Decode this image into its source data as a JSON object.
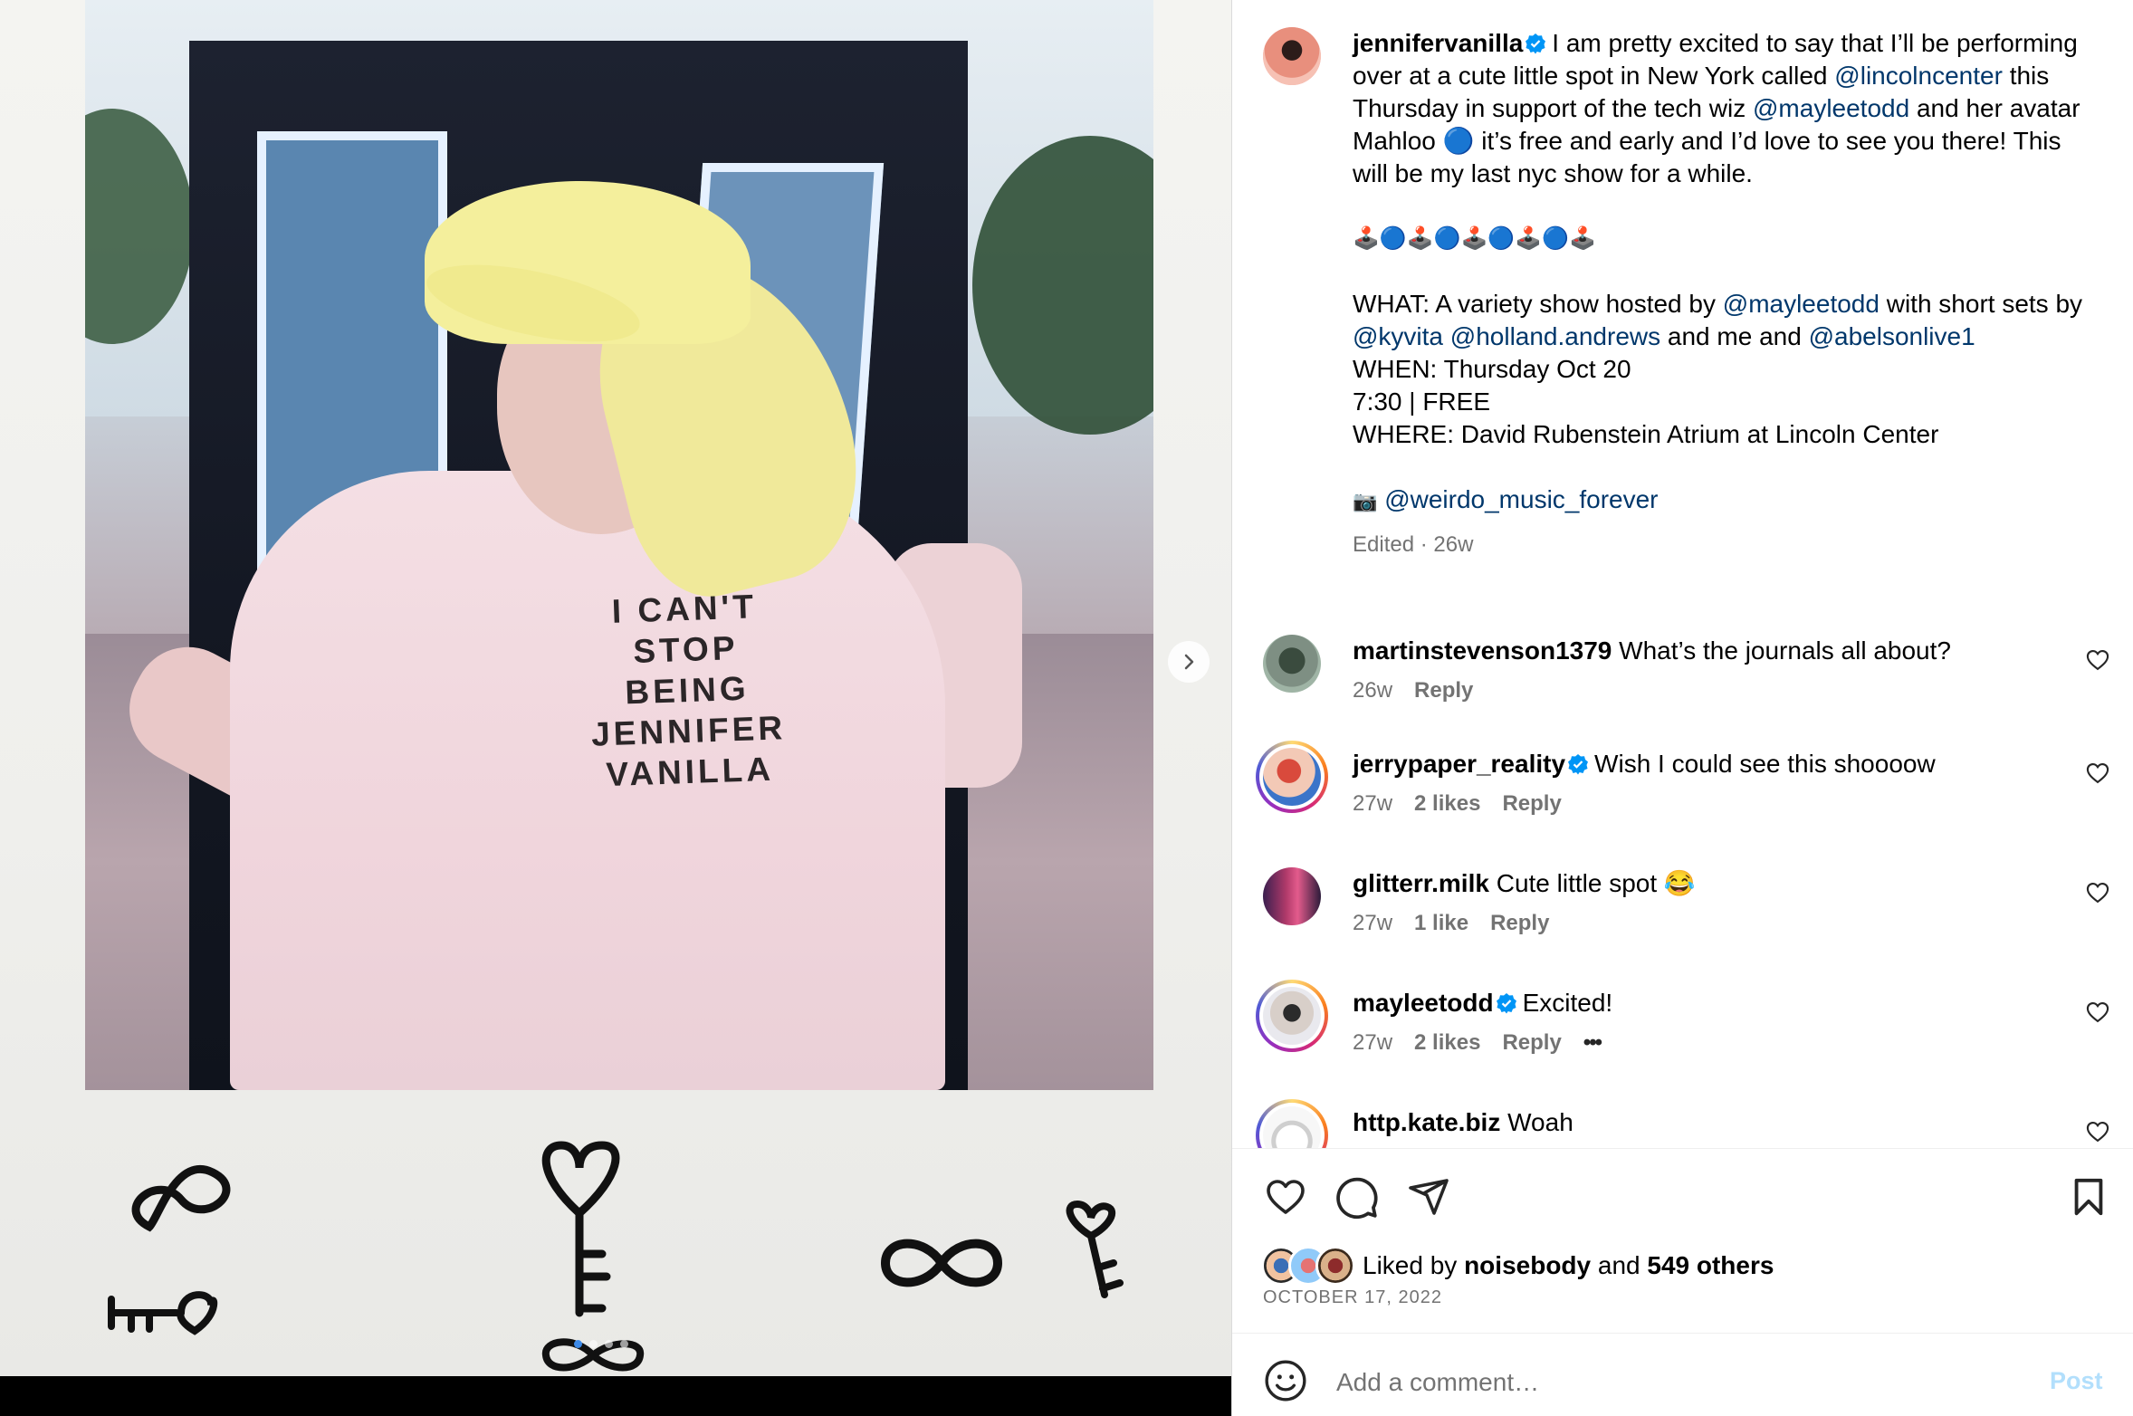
{
  "photo": {
    "shirt_text": "I CAN'T\nSTOP\nBEING\nJENNIFER\nVANILLA"
  },
  "post": {
    "author": "jennifervanilla",
    "caption_parts": {
      "p1a": "I am pretty excited to say that I’ll be performing over at a cute little spot in New York called ",
      "m1": "@lincolncenter",
      "p1b": " this Thursday in support of the tech wiz ",
      "m2": "@mayleetodd",
      "p1c": " and her avatar Mahloo 🔵 it’s free and early and I’d love to see you there! This will be my last nyc show for a while.",
      "emoji_row": "🕹️🔵🕹️🔵🕹️🔵🕹️🔵🕹️",
      "what_a": "WHAT: A variety show hosted by ",
      "what_m1": "@mayleetodd",
      "what_b": " with short sets by ",
      "what_m2": "@kyvita",
      "what_m3": "@holland.andrews",
      "what_c": " and me and ",
      "what_m4": "@abelsonlive1",
      "when": "WHEN: Thursday Oct 20",
      "time": "7:30 | FREE",
      "where": "WHERE: David Rubenstein Atrium at Lincoln Center",
      "camera": "📷",
      "credit": "@weirdo_music_forever"
    },
    "edited": "Edited · 26w"
  },
  "comments": [
    {
      "user": "martinstevenson1379",
      "verified": false,
      "text": "What’s the journals all about?",
      "time": "26w",
      "likes": "",
      "reply": "Reply"
    },
    {
      "user": "jerrypaper_reality",
      "verified": true,
      "text": "Wish I could see this shoooow",
      "time": "27w",
      "likes": "2 likes",
      "reply": "Reply"
    },
    {
      "user": "glitterr.milk",
      "verified": false,
      "text": "Cute little spot 😂",
      "time": "27w",
      "likes": "1 like",
      "reply": "Reply"
    },
    {
      "user": "mayleetodd",
      "verified": true,
      "text": "Excited!",
      "time": "27w",
      "likes": "2 likes",
      "reply": "Reply",
      "more": "•••"
    },
    {
      "user": "http.kate.biz",
      "verified": false,
      "text": "Woah"
    }
  ],
  "likes": {
    "prefix": "Liked by ",
    "user": "noisebody",
    "middle": " and ",
    "count": "549 others"
  },
  "date": "OCTOBER 17, 2022",
  "comment_box": {
    "placeholder": "Add a comment…",
    "post_label": "Post"
  },
  "colors": {
    "link": "#00376b",
    "verified": "#0095f6",
    "meta": "#737373",
    "post_disabled": "#b2dffc"
  },
  "icons": [
    "heart-icon",
    "comment-icon",
    "share-icon",
    "bookmark-icon",
    "emoji-icon",
    "chevron-right-icon",
    "verified-icon"
  ]
}
